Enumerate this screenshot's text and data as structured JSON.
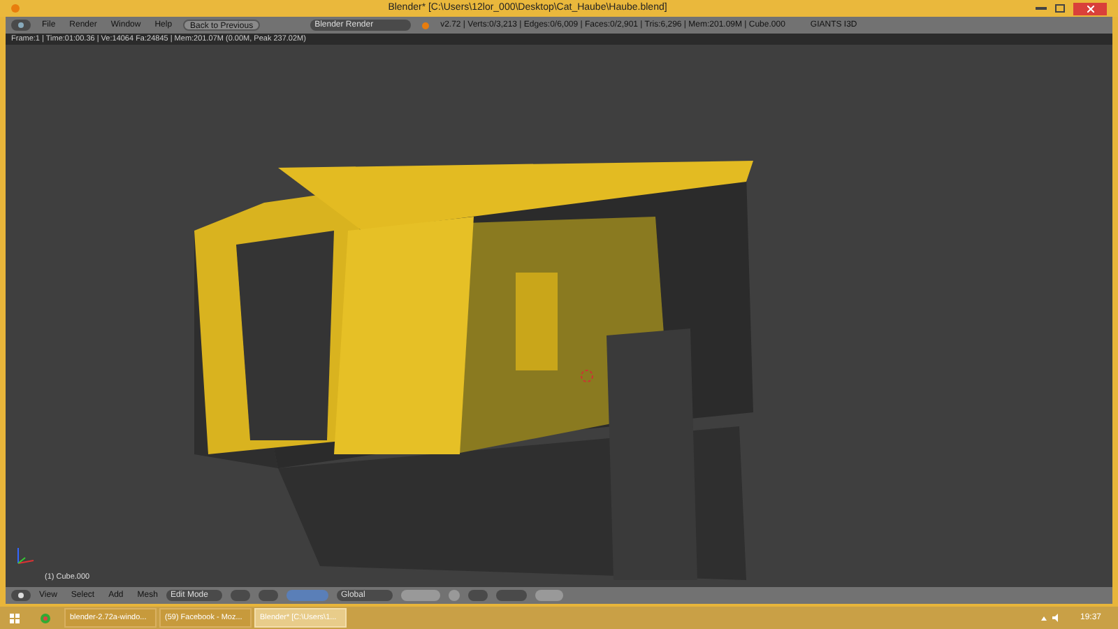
{
  "window": {
    "title": "Blender* [C:\\Users\\12lor_000\\Desktop\\Cat_Haube\\Haube.blend]"
  },
  "menu_bar": {
    "menus": [
      "File",
      "Render",
      "Window",
      "Help"
    ],
    "back_button": "Back to Previous",
    "render_engine": "Blender Render",
    "stats": "v2.72 | Verts:0/3,213 | Edges:0/6,009 | Faces:0/2,901 | Tris:6,296 | Mem:201.09M | Cube.000",
    "addon_label": "GIANTS I3D"
  },
  "info_line": "Frame:1 | Time:01:00.36 | Ve:14064 Fa:24845 | Mem:201.07M (0.00M, Peak 237.02M)",
  "viewport": {
    "object_label": "(1) Cube.000"
  },
  "viewport_header": {
    "menus": [
      "View",
      "Select",
      "Add",
      "Mesh"
    ],
    "mode": "Edit Mode",
    "orientation": "Global"
  },
  "taskbar": {
    "tasks": [
      {
        "label": "blender-2.72a-windo...",
        "selected": false
      },
      {
        "label": "(59) Facebook - Moz...",
        "selected": false
      },
      {
        "label": "Blender* [C:\\Users\\1...",
        "selected": true
      }
    ],
    "clock": "19:37"
  }
}
